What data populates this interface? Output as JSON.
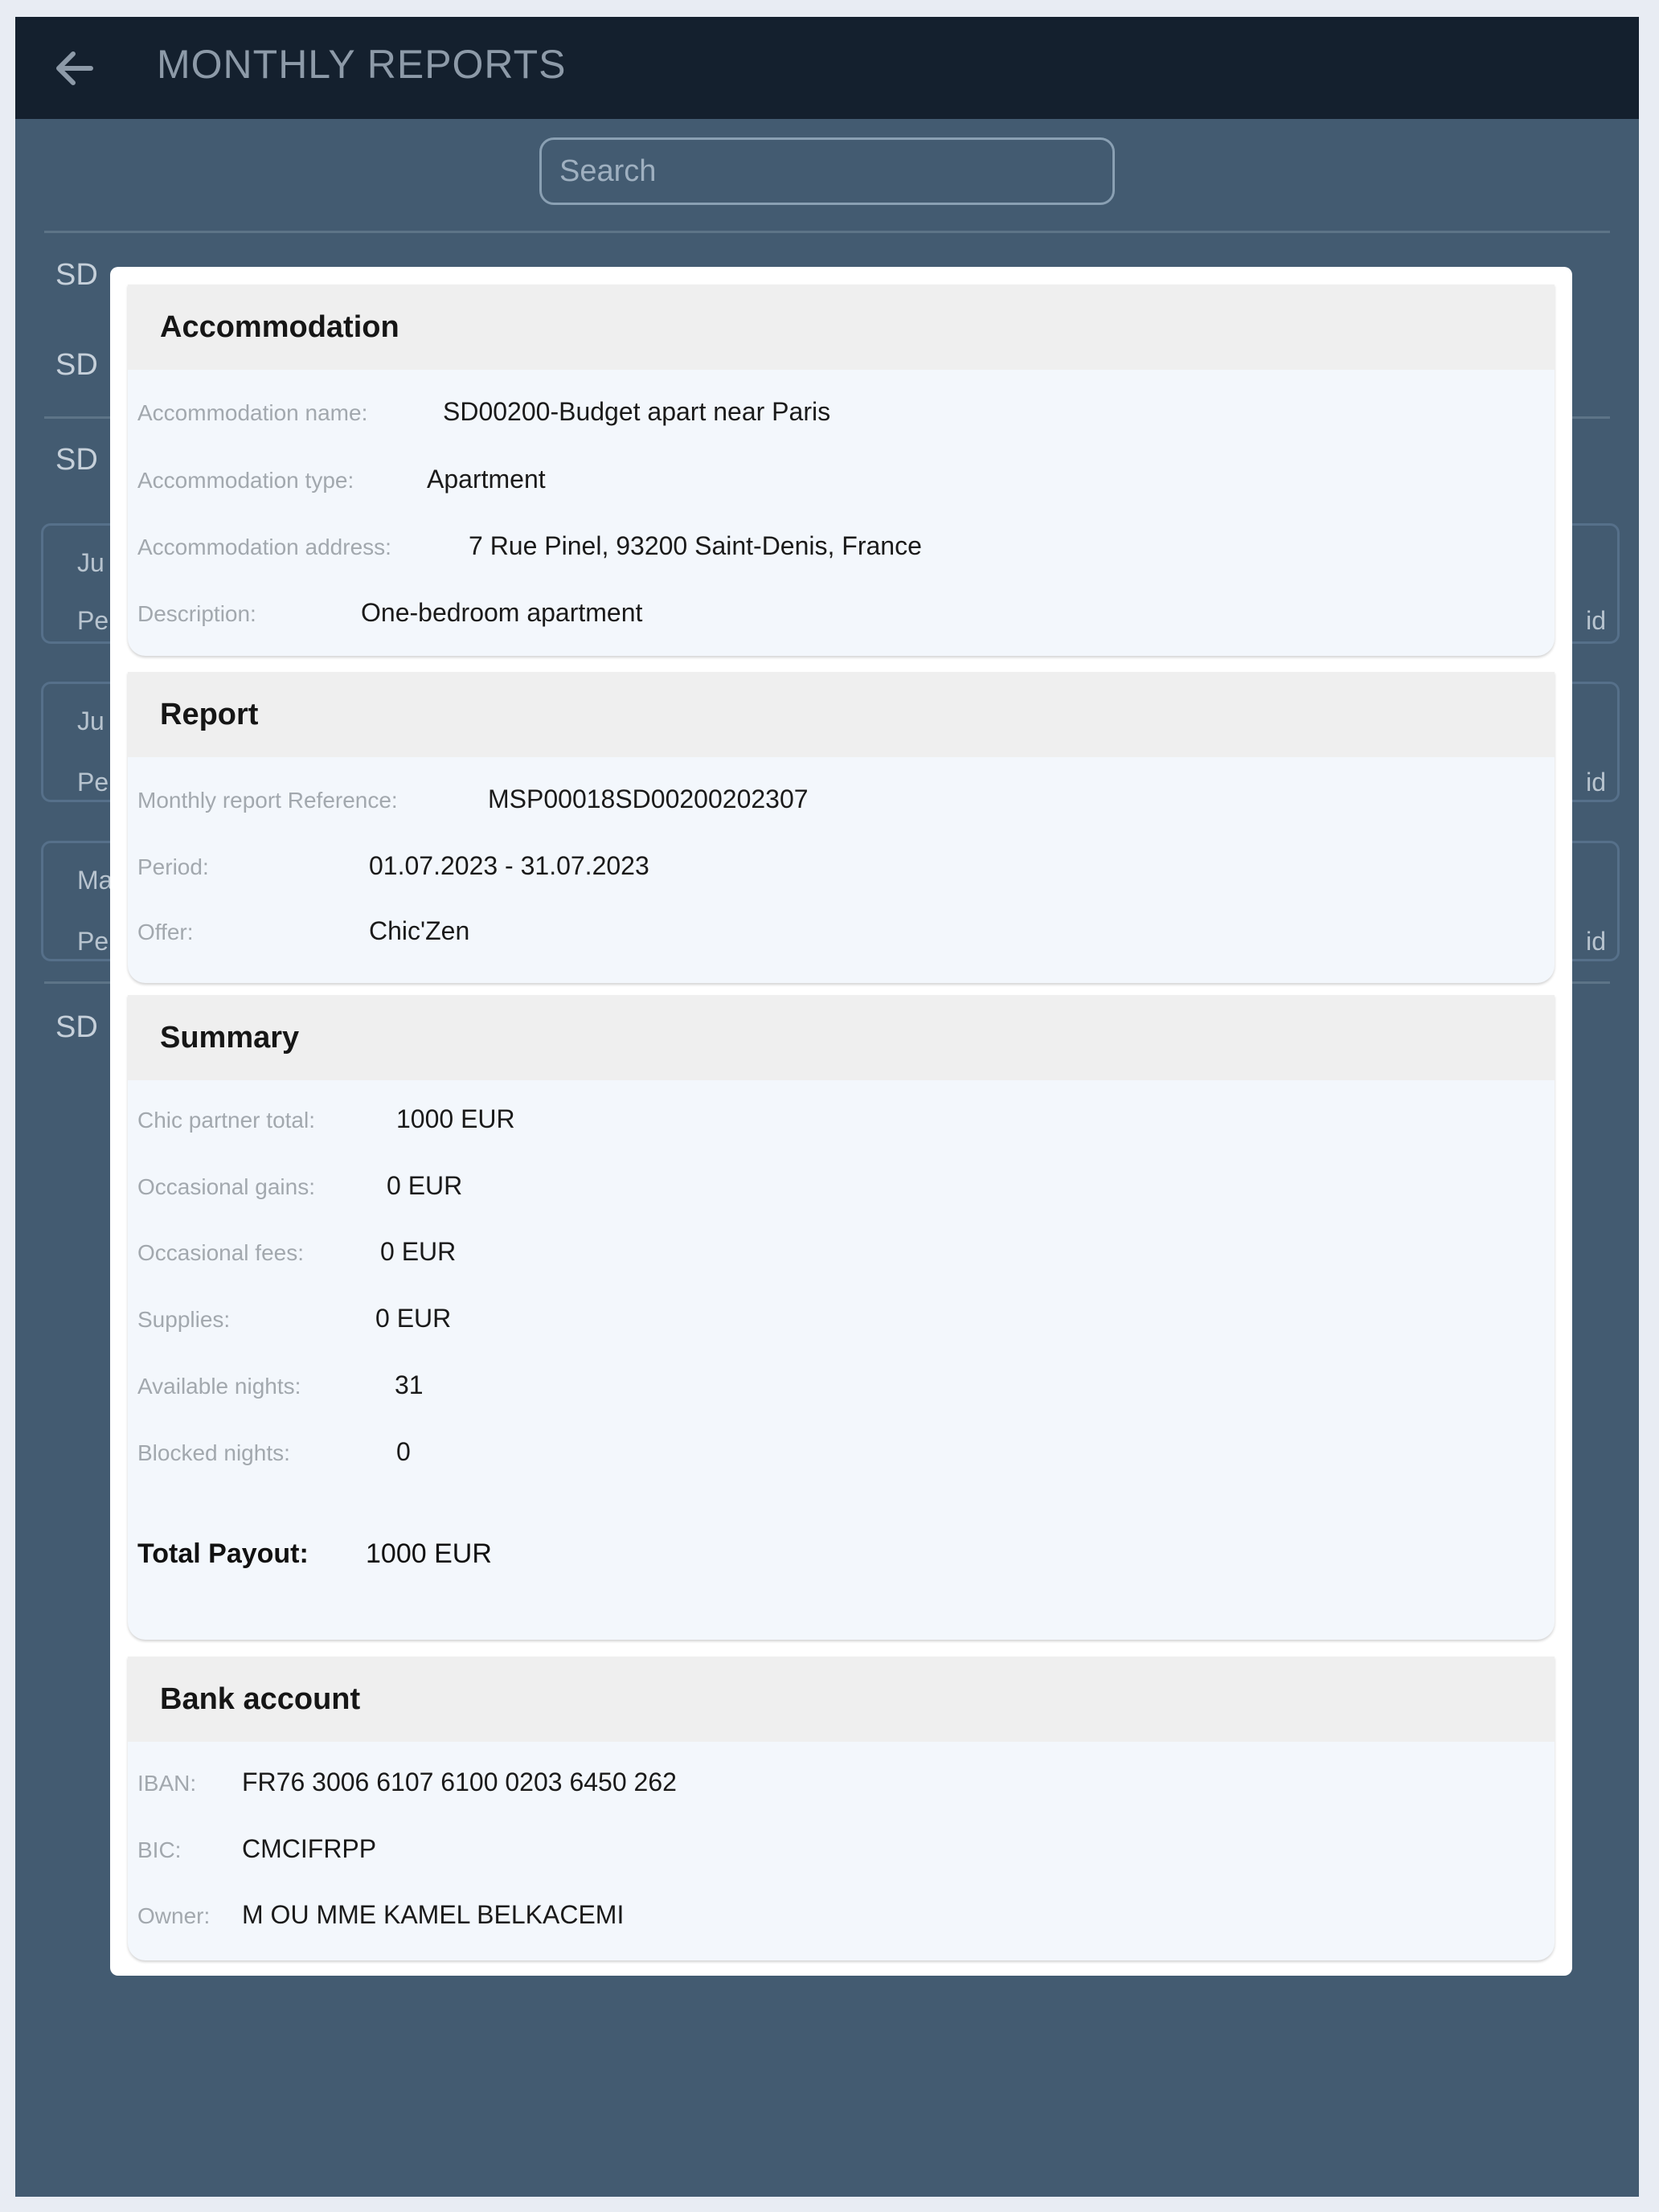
{
  "header": {
    "title": "MONTHLY REPORTS",
    "back_icon": "arrow-left-icon"
  },
  "search": {
    "placeholder": "Search"
  },
  "background_list": {
    "rows": [
      {
        "prefix": "SD"
      },
      {
        "prefix": "SD"
      },
      {
        "prefix": "SD"
      },
      {
        "prefix": "SD"
      }
    ],
    "cards": [
      {
        "prefix_top": "Ju",
        "prefix_bottom": "Pe",
        "suffix": "id"
      },
      {
        "prefix_top": "Ju",
        "prefix_bottom": "Pe",
        "suffix": "id"
      },
      {
        "prefix_top": "Ma",
        "prefix_bottom": "Pe",
        "suffix": "id"
      }
    ]
  },
  "modal": {
    "accommodation": {
      "title": "Accommodation",
      "fields": [
        {
          "label": "Accommodation name:",
          "value": "SD00200-Budget apart near Paris"
        },
        {
          "label": "Accommodation type:",
          "value": "Apartment"
        },
        {
          "label": "Accommodation address:",
          "value": "7 Rue Pinel, 93200 Saint-Denis, France"
        },
        {
          "label": "Description:",
          "value": "One-bedroom apartment"
        }
      ]
    },
    "report": {
      "title": "Report",
      "fields": [
        {
          "label": "Monthly report Reference:",
          "value": "MSP00018SD00200202307"
        },
        {
          "label": "Period:",
          "value": "01.07.2023 - 31.07.2023"
        },
        {
          "label": "Offer:",
          "value": "Chic'Zen"
        }
      ]
    },
    "summary": {
      "title": "Summary",
      "fields": [
        {
          "label": "Chic partner total:",
          "value": "1000 EUR"
        },
        {
          "label": "Occasional gains:",
          "value": "0 EUR"
        },
        {
          "label": "Occasional fees:",
          "value": "0 EUR"
        },
        {
          "label": "Supplies:",
          "value": "0 EUR"
        },
        {
          "label": "Available nights:",
          "value": "31"
        },
        {
          "label": "Blocked nights:",
          "value": "0"
        }
      ],
      "total": {
        "label": "Total Payout:",
        "value": "1000 EUR"
      }
    },
    "bank_account": {
      "title": "Bank account",
      "fields": [
        {
          "label": "IBAN:",
          "value": "FR76 3006 6107 6100 0203 6450 262"
        },
        {
          "label": "BIC:",
          "value": "CMCIFRPP"
        },
        {
          "label": "Owner:",
          "value": "M OU MME KAMEL BELKACEMI"
        }
      ]
    }
  },
  "colors": {
    "topbar": "#14202e",
    "backdrop": "#435b71",
    "modal": "#ffffff",
    "section_header": "#efefef",
    "section_body": "#f3f7fc"
  }
}
